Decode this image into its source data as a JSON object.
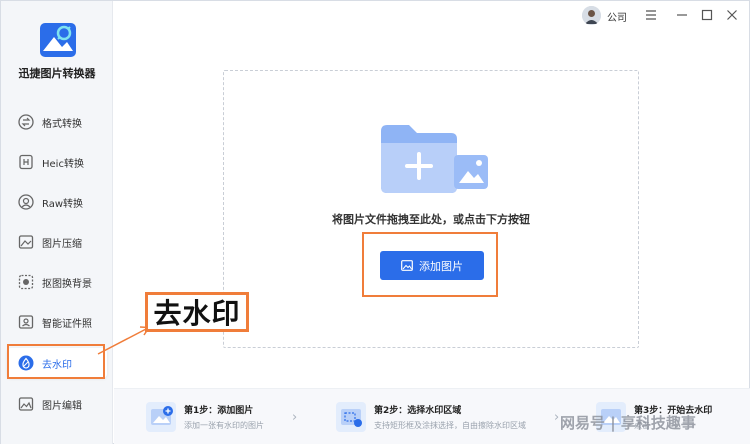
{
  "app": {
    "name": "迅捷图片转换器",
    "user": "公司"
  },
  "sidebar": {
    "items": [
      {
        "label": "格式转换",
        "icon": "convert-icon"
      },
      {
        "label": "Heic转换",
        "icon": "heic-icon"
      },
      {
        "label": "Raw转换",
        "icon": "raw-icon"
      },
      {
        "label": "图片压缩",
        "icon": "compress-icon"
      },
      {
        "label": "抠图换背景",
        "icon": "cutout-icon"
      },
      {
        "label": "智能证件照",
        "icon": "id-photo-icon"
      },
      {
        "label": "去水印",
        "icon": "watermark-icon",
        "active": true
      },
      {
        "label": "图片编辑",
        "icon": "edit-icon"
      }
    ]
  },
  "main": {
    "drop_hint": "将图片文件拖拽至此处，或点击下方按钮",
    "add_button": "添加图片"
  },
  "steps": [
    {
      "title": "第1步：添加图片",
      "desc": "添加一张有水印的图片"
    },
    {
      "title": "第2步：选择水印区域",
      "desc": "支持矩形框及涂抹选择，自由擦除水印区域"
    },
    {
      "title": "第3步：开始去水印",
      "desc": "点击"
    }
  ],
  "annotation": {
    "callout": "去水印"
  },
  "overlay": {
    "watermark": "网易号 | 享科技趣事"
  },
  "colors": {
    "accent": "#2b6de9",
    "highlight": "#f07d3a"
  }
}
